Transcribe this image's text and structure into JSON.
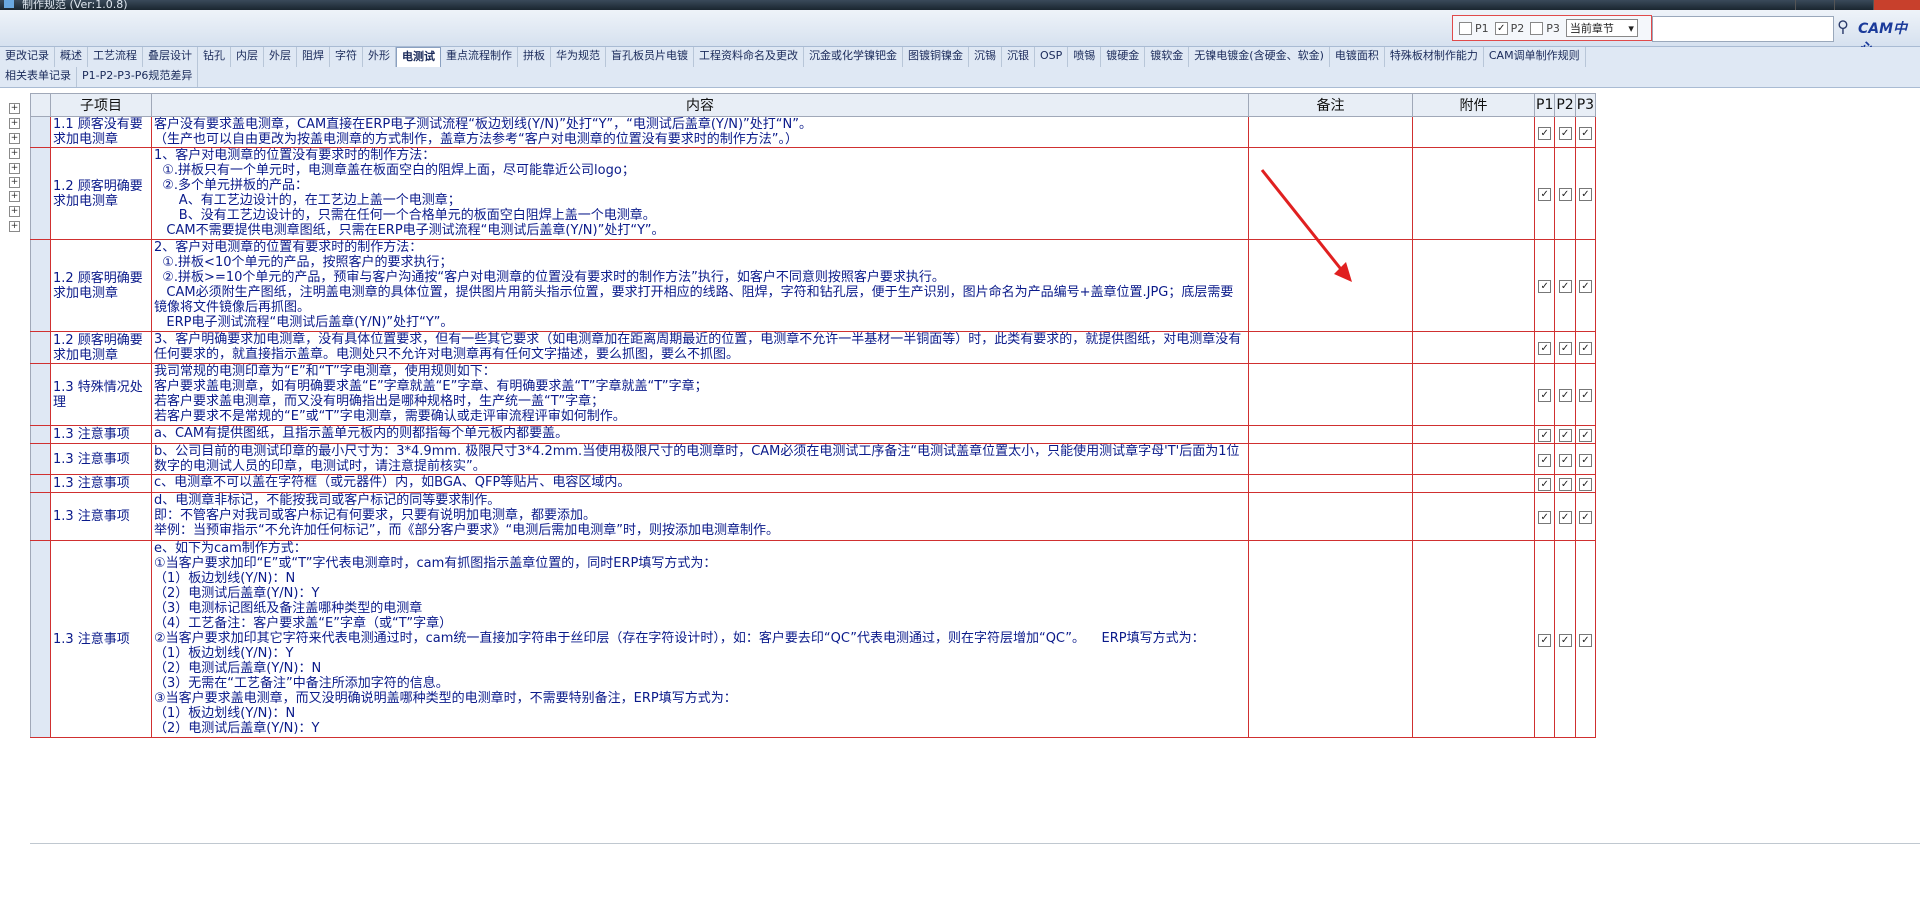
{
  "window": {
    "title": "制作规范 (Ver:1.0.8)"
  },
  "filter": {
    "p1": "P1",
    "p2": "P2",
    "p3": "P3",
    "p1_checked": false,
    "p2_checked": true,
    "p3_checked": false,
    "scope": "当前章节"
  },
  "search": {
    "placeholder": ""
  },
  "logo": {
    "text": "CAM中心"
  },
  "tabs_row1": [
    "更改记录",
    "概述",
    "工艺流程",
    "叠层设计",
    "钻孔",
    "内层",
    "外层",
    "阻焊",
    "字符",
    "外形",
    "电测试",
    "重点流程制作",
    "拼板",
    "华为规范",
    "盲孔板员片电镀",
    "工程资料命名及更改",
    "沉金或化学镍钯金",
    "图镀铜镍金",
    "沉锡",
    "沉银",
    "OSP",
    "喷锡",
    "镀硬金",
    "镀软金",
    "无镍电镀金(含硬金、软金)",
    "电镀面积",
    "特殊板材制作能力",
    "CAM调单制作规则"
  ],
  "active_tab": "电测试",
  "tabs_row2": [
    "相关表单记录",
    "P1-P2-P3-P6规范差异"
  ],
  "columns": {
    "item": "子项目",
    "content": "内容",
    "remark": "备注",
    "attach": "附件",
    "p1": "P1",
    "p2": "P2",
    "p3": "P3"
  },
  "rows": [
    {
      "item": "1.1 顾客没有要求加电测章",
      "content": "客户没有要求盖电测章，CAM直接在ERP电子测试流程“板边划线(Y/N)”处打“Y”，“电测试后盖章(Y/N)”处打“N”。\n（生产也可以自由更改为按盖电测章的方式制作，盖章方法参考“客户对电测章的位置没有要求时的制作方法”。）"
    },
    {
      "item": "1.2 顾客明确要求加电测章",
      "content": "1、客户对电测章的位置没有要求时的制作方法：\n  ①.拼板只有一个单元时，电测章盖在板面空白的阻焊上面，尽可能靠近公司logo；\n  ②.多个单元拼板的产品：\n      A、有工艺边设计的，在工艺边上盖一个电测章；\n      B、没有工艺边设计的，只需在任何一个合格单元的板面空白阻焊上盖一个电测章。\n   CAM不需要提供电测章图纸，只需在ERP电子测试流程“电测试后盖章(Y/N)”处打“Y”。"
    },
    {
      "item": "1.2 顾客明确要求加电测章",
      "content": "2、客户对电测章的位置有要求时的制作方法：\n  ①.拼板<10个单元的产品，按照客户的要求执行；\n  ②.拼板>=10个单元的产品，预审与客户沟通按“客户对电测章的位置没有要求时的制作方法”执行，如客户不同意则按照客户要求执行。\n   CAM必须附生产图纸，注明盖电测章的具体位置，提供图片用箭头指示位置，要求打开相应的线路、阻焊，字符和钻孔层，便于生产识别，图片命名为产品编号+盖章位置.JPG；底层需要镜像将文件镜像后再抓图。\n   ERP电子测试流程“电测试后盖章(Y/N)”处打“Y”。"
    },
    {
      "item": "1.2 顾客明确要求加电测章",
      "content": "3、客户明确要求加电测章，没有具体位置要求，但有一些其它要求（如电测章加在距离周期最近的位置，电测章不允许一半基材一半铜面等）时，此类有要求的，就提供图纸，对电测章没有任何要求的，就直接指示盖章。电测处只不允许对电测章再有任何文字描述，要么抓图，要么不抓图。"
    },
    {
      "item": "1.3 特殊情况处理",
      "content": "我司常规的电测印章为“E”和“T”字电测章，使用规则如下：\n客户要求盖电测章，如有明确要求盖“E”字章就盖“E”字章、有明确要求盖“T”字章就盖“T”字章；\n若客户要求盖电测章，而又没有明确指出是哪种规格时，生产统一盖“T”字章；\n若客户要求不是常规的“E”或“T”字电测章，需要确认或走评审流程评审如何制作。"
    },
    {
      "item": "1.3 注意事项",
      "content": "a、CAM有提供图纸，且指示盖单元板内的则都指每个单元板内都要盖。"
    },
    {
      "item": "1.3 注意事项",
      "content": "b、公司目前的电测试印章的最小尺寸为：3*4.9mm. 极限尺寸3*4.2mm.当使用极限尺寸的电测章时，CAM必须在电测试工序备注“电测试盖章位置太小，只能使用测试章字母'T'后面为1位数字的电测试人员的印章，电测试时，请注意提前核实”。"
    },
    {
      "item": "1.3 注意事项",
      "content": "c、电测章不可以盖在字符框（或元器件）内，如BGA、QFP等贴片、电容区域内。"
    },
    {
      "item": "1.3 注意事项",
      "content": "d、电测章非标记，不能按我司或客户标记的同等要求制作。\n即：不管客户对我司或客户标记有何要求，只要有说明加电测章，都要添加。\n举例：当预审指示“不允许加任何标记”，而《部分客户要求》“电测后需加电测章”时，则按添加电测章制作。"
    },
    {
      "item": "1.3 注意事项",
      "content": "e、如下为cam制作方式：\n①当客户要求加印“E”或“T”字代表电测章时，cam有抓图指示盖章位置的，同时ERP填写方式为：\n（1）板边划线(Y/N)：N\n（2）电测试后盖章(Y/N)：Y\n（3）电测标记图纸及备注盖哪种类型的电测章\n（4）工艺备注：客户要求盖“E”字章（或“T”字章）\n②当客户要求加印其它字符来代表电测通过时，cam统一直接加字符串于丝印层（存在字符设计时），如：客户要去印“QC”代表电测通过，则在字符层增加“QC”。    ERP填写方式为：\n（1）板边划线(Y/N)：Y\n（2）电测试后盖章(Y/N)：N\n（3）无需在“工艺备注”中备注所添加字符的信息。\n③当客户要求盖电测章，而又没明确说明盖哪种类型的电测章时，不需要特别备注，ERP填写方式为：\n（1）板边划线(Y/N)：N\n（2）电测试后盖章(Y/N)：Y"
    }
  ],
  "checkmark": "✓",
  "colors": {
    "row_border": "#d03030",
    "text": "#0a1a8a",
    "arrow": "#e02020"
  }
}
